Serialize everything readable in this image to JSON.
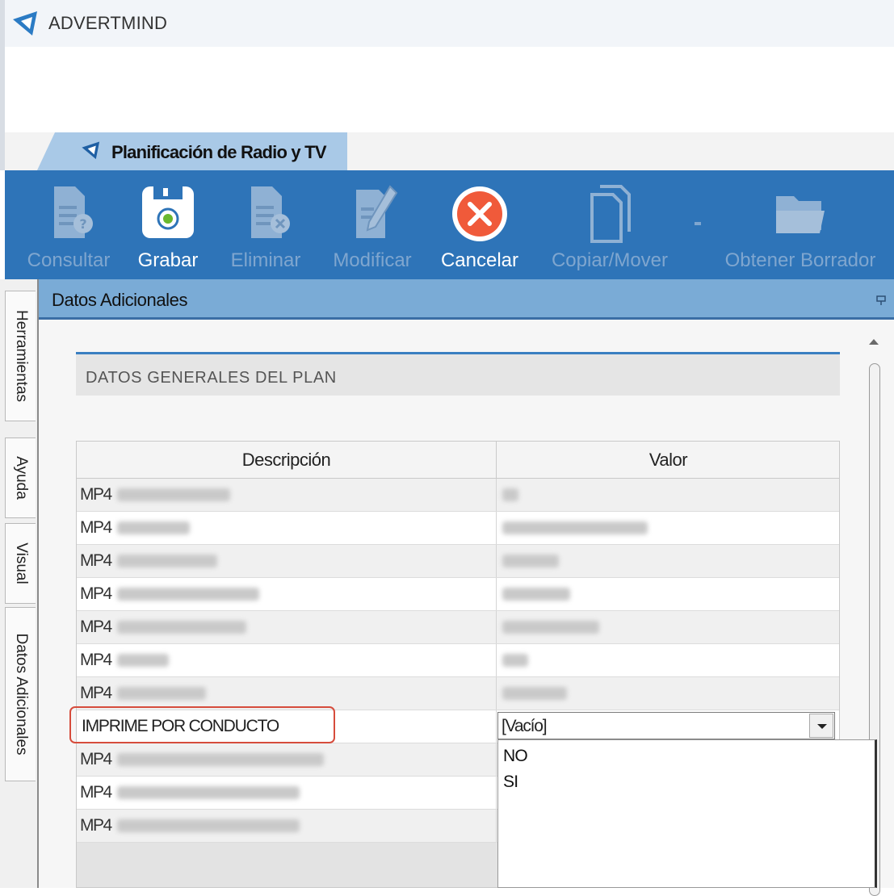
{
  "app": {
    "title": "ADVERTMIND"
  },
  "document_tab": {
    "label": "Planificación de Radio y TV"
  },
  "toolbar": {
    "buttons": [
      {
        "label": "Consultar",
        "icon": "document-query-icon",
        "enabled": false
      },
      {
        "label": "Grabar",
        "icon": "save-disk-icon",
        "enabled": true
      },
      {
        "label": "Eliminar",
        "icon": "document-delete-icon",
        "enabled": false
      },
      {
        "label": "Modificar",
        "icon": "document-edit-icon",
        "enabled": false
      },
      {
        "label": "Cancelar",
        "icon": "cancel-circle-icon",
        "enabled": true
      },
      {
        "label": "Copiar/Mover",
        "icon": "copy-icon",
        "enabled": false
      },
      {
        "label": "Obtener Borrador",
        "icon": "folder-open-icon",
        "enabled": false
      }
    ]
  },
  "side_tabs": [
    "Herramientas",
    "Ayuda",
    "Visual",
    "Datos Adicionales"
  ],
  "panel": {
    "title": "Datos Adicionales"
  },
  "section": {
    "title": "DATOS GENERALES DEL PLAN"
  },
  "grid": {
    "columns": [
      "Descripción",
      "Valor"
    ],
    "rows": [
      {
        "descripcion": "MP4",
        "valor": "",
        "blurred": true
      },
      {
        "descripcion": "MP4",
        "valor": "",
        "blurred": true
      },
      {
        "descripcion": "MP4",
        "valor": "",
        "blurred": true
      },
      {
        "descripcion": "MP4",
        "valor": "",
        "blurred": true
      },
      {
        "descripcion": "MP4",
        "valor": "",
        "blurred": true
      },
      {
        "descripcion": "MP4",
        "valor": "",
        "blurred": true
      },
      {
        "descripcion": "MP4",
        "valor": "",
        "blurred": true
      },
      {
        "descripcion": "IMPRIME POR CONDUCTO",
        "valor": "[Vacío]",
        "blurred": false,
        "editing": true
      },
      {
        "descripcion": "MP4",
        "valor": "",
        "blurred": true
      },
      {
        "descripcion": "MP4",
        "valor": "",
        "blurred": true
      },
      {
        "descripcion": "MP4",
        "valor": "",
        "blurred": true
      }
    ]
  },
  "combo": {
    "value": "[Vacío]",
    "options": [
      "NO",
      "SI"
    ]
  },
  "colors": {
    "ribbon": "#2e74b8",
    "panel_header": "#7aabd6",
    "highlight": "#d64c3c",
    "section_rule": "#3a7fc1"
  }
}
